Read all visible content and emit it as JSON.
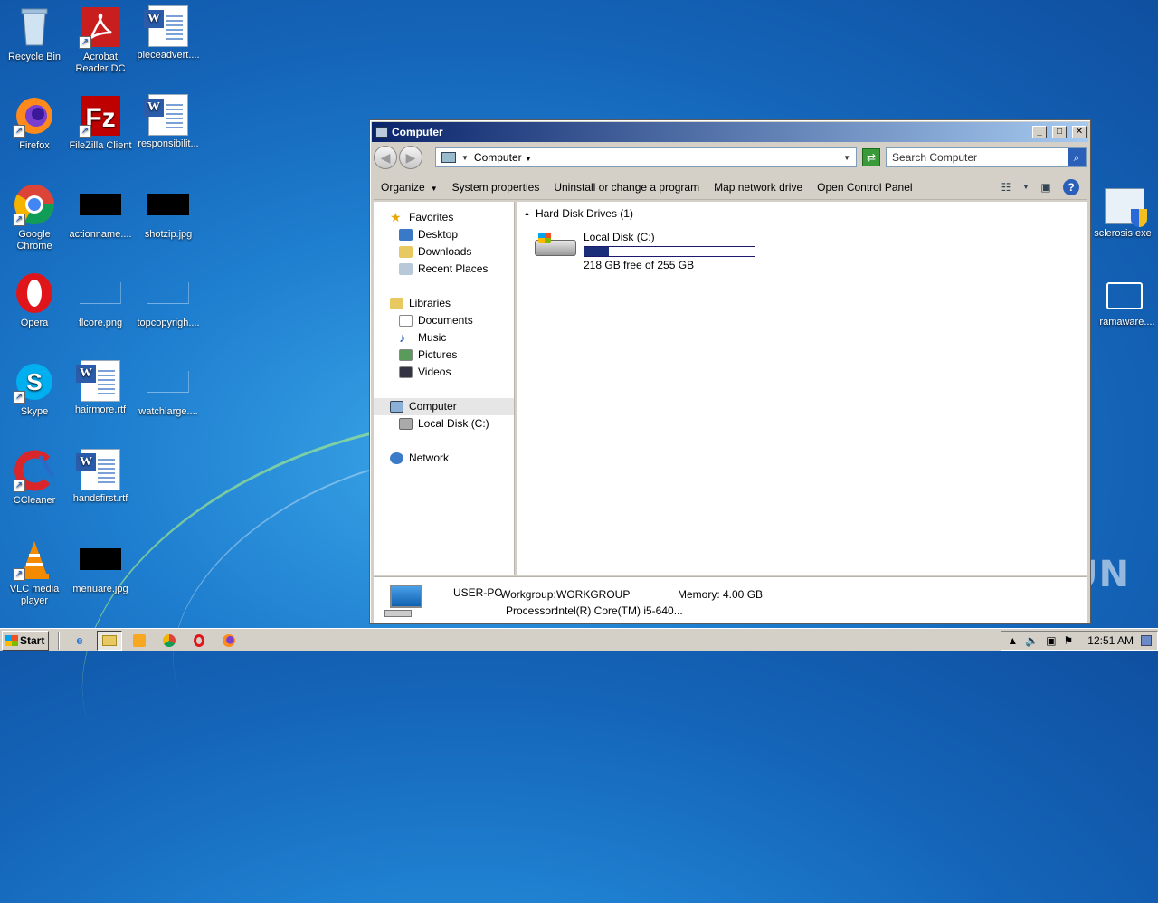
{
  "desktop": {
    "icons": [
      {
        "label": "Recycle Bin",
        "icon": "recycle-bin-icon"
      },
      {
        "label": "Acrobat Reader DC",
        "icon": "acrobat-icon"
      },
      {
        "label": "pieceadvert....",
        "icon": "word-doc-icon"
      },
      {
        "label": "Firefox",
        "icon": "firefox-icon"
      },
      {
        "label": "FileZilla Client",
        "icon": "filezilla-icon"
      },
      {
        "label": "responsibilit...",
        "icon": "word-doc-icon"
      },
      {
        "label": "Google Chrome",
        "icon": "chrome-icon"
      },
      {
        "label": "actionname....",
        "icon": "image-thumb-icon"
      },
      {
        "label": "shotzip.jpg",
        "icon": "image-thumb-icon"
      },
      {
        "label": "Opera",
        "icon": "opera-icon"
      },
      {
        "label": "flcore.png",
        "icon": "image-thumb-icon"
      },
      {
        "label": "topcopyrigh....",
        "icon": "image-thumb-icon"
      },
      {
        "label": "Skype",
        "icon": "skype-icon"
      },
      {
        "label": "hairmore.rtf",
        "icon": "word-doc-icon"
      },
      {
        "label": "watchlarge....",
        "icon": "image-thumb-icon"
      },
      {
        "label": "CCleaner",
        "icon": "ccleaner-icon"
      },
      {
        "label": "handsfirst.rtf",
        "icon": "word-doc-icon"
      },
      {
        "label": "VLC media player",
        "icon": "vlc-icon"
      },
      {
        "label": "menuare.jpg",
        "icon": "image-thumb-icon"
      }
    ],
    "right_icons": [
      {
        "label": "sclerosis.exe"
      },
      {
        "label": "ramaware...."
      }
    ],
    "watermark": "ANY RUN"
  },
  "window": {
    "title": "Computer",
    "controls": {
      "min": "_",
      "max": "□",
      "close": "✕"
    },
    "address": {
      "path": "Computer"
    },
    "search": {
      "placeholder": "Search Computer"
    },
    "commands": [
      {
        "label": "Organize",
        "dropdown": true
      },
      {
        "label": "System properties"
      },
      {
        "label": "Uninstall or change a program"
      },
      {
        "label": "Map network drive"
      },
      {
        "label": "Open Control Panel"
      }
    ],
    "nav": {
      "favorites": {
        "label": "Favorites",
        "items": [
          "Desktop",
          "Downloads",
          "Recent Places"
        ]
      },
      "libraries": {
        "label": "Libraries",
        "items": [
          "Documents",
          "Music",
          "Pictures",
          "Videos"
        ]
      },
      "computer": {
        "label": "Computer",
        "items": [
          "Local Disk (C:)"
        ]
      },
      "network": {
        "label": "Network"
      }
    },
    "content": {
      "group_title": "Hard Disk Drives (1)",
      "drive": {
        "name": "Local Disk (C:)",
        "free_text": "218 GB free of 255 GB",
        "used_fraction": 0.145
      }
    },
    "details": {
      "pc_name": "USER-PC",
      "workgroup_label": "Workgroup:",
      "workgroup_value": "WORKGROUP",
      "memory_label": "Memory:",
      "memory_value": "4.00 GB",
      "processor_label": "Processor:",
      "processor_value": "Intel(R) Core(TM) i5-640..."
    }
  },
  "taskbar": {
    "start_label": "Start",
    "clock": "12:51 AM"
  }
}
